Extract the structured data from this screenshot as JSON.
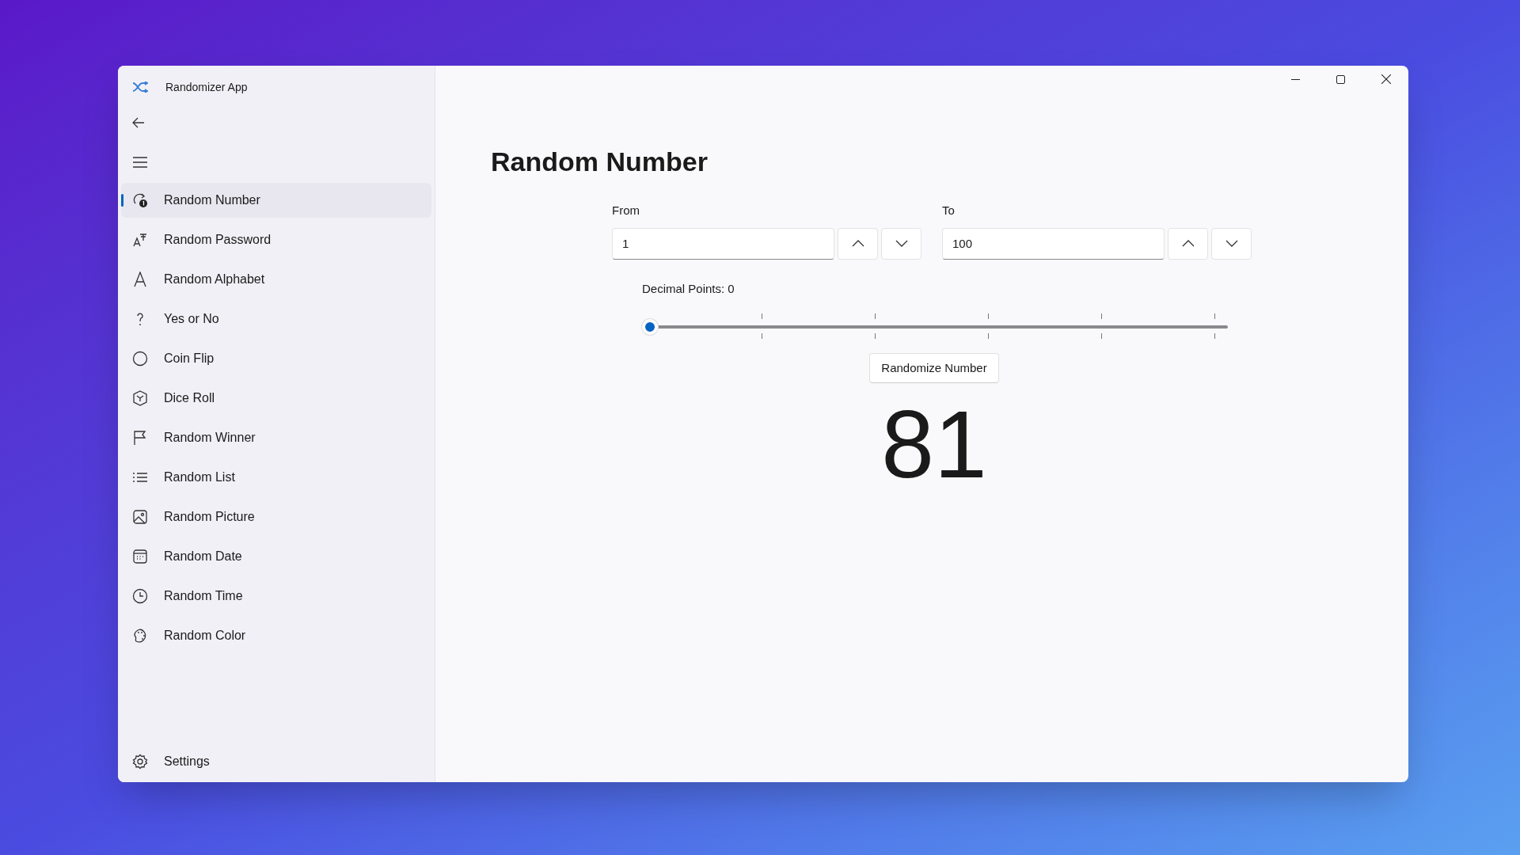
{
  "window": {
    "title": "Randomizer App"
  },
  "sidebar": {
    "items": [
      {
        "label": "Random Number",
        "kind": "number",
        "selected": true
      },
      {
        "label": "Random Password",
        "kind": "password",
        "selected": false
      },
      {
        "label": "Random Alphabet",
        "kind": "alphabet",
        "selected": false
      },
      {
        "label": "Yes or No",
        "kind": "question",
        "selected": false
      },
      {
        "label": "Coin Flip",
        "kind": "coin",
        "selected": false
      },
      {
        "label": "Dice Roll",
        "kind": "dice",
        "selected": false
      },
      {
        "label": "Random Winner",
        "kind": "flag",
        "selected": false
      },
      {
        "label": "Random List",
        "kind": "list",
        "selected": false
      },
      {
        "label": "Random Picture",
        "kind": "picture",
        "selected": false
      },
      {
        "label": "Random Date",
        "kind": "calendar",
        "selected": false
      },
      {
        "label": "Random Time",
        "kind": "clock",
        "selected": false
      },
      {
        "label": "Random Color",
        "kind": "palette",
        "selected": false
      }
    ],
    "footer_items": [
      {
        "label": "Settings",
        "kind": "gear",
        "selected": false
      }
    ]
  },
  "page": {
    "title": "Random Number",
    "from": {
      "label": "From",
      "value": "1"
    },
    "to": {
      "label": "To",
      "value": "100"
    },
    "decimal_points": {
      "label": "Decimal Points: 0",
      "level": 0
    },
    "button": "Randomize Number",
    "result": "81"
  }
}
